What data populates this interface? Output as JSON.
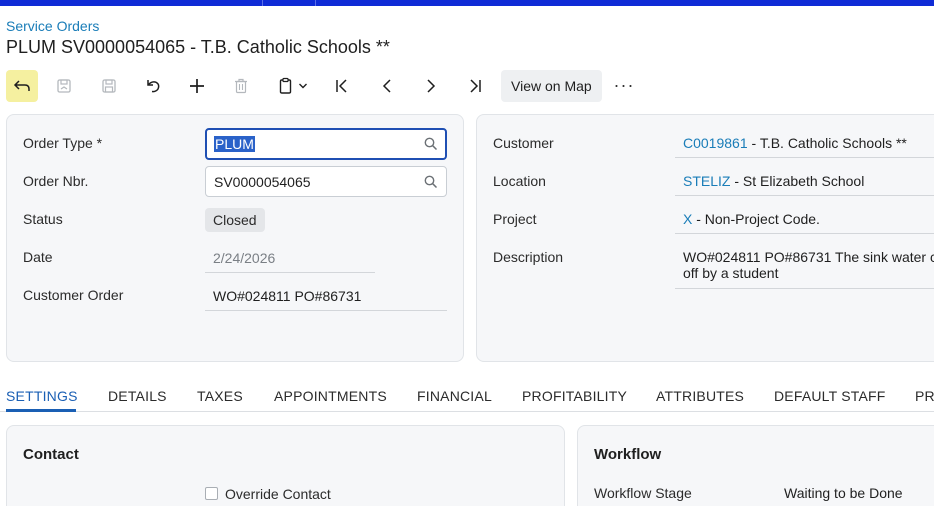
{
  "breadcrumb": "Service Orders",
  "title": "PLUM SV0000054065 - T.B. Catholic Schools **",
  "toolbar": {
    "icons": [
      "back-icon",
      "save-close-icon",
      "save-icon",
      "undo-icon",
      "add-icon",
      "delete-icon",
      "copy-paste-icon",
      "first-record-icon",
      "previous-record-icon",
      "next-record-icon",
      "last-record-icon"
    ],
    "view_on_map": "View on Map",
    "more": "···"
  },
  "left": {
    "order_type_label": "Order Type *",
    "order_type_value": "PLUM",
    "order_nbr_label": "Order Nbr.",
    "order_nbr_value": "SV0000054065",
    "status_label": "Status",
    "status_value": "Closed",
    "date_label": "Date",
    "date_value": "2/24/2026",
    "customer_order_label": "Customer Order",
    "customer_order_value": "WO#024811 PO#86731"
  },
  "right": {
    "customer_label": "Customer",
    "customer_id": "C0019861",
    "customer_name": " - T.B. Catholic Schools **",
    "location_label": "Location",
    "location_id": "STELIZ",
    "location_name": " - St Elizabeth School",
    "project_label": "Project",
    "project_id": "X",
    "project_name": " - Non-Project Code.",
    "description_label": "Description",
    "description_line1": "WO#024811 PO#86731 The sink water c",
    "description_line2": "off by a student"
  },
  "tabs": [
    "SETTINGS",
    "DETAILS",
    "TAXES",
    "APPOINTMENTS",
    "FINANCIAL",
    "PROFITABILITY",
    "ATTRIBUTES",
    "DEFAULT STAFF",
    "PR"
  ],
  "contact": {
    "title": "Contact",
    "override_label": "Override Contact"
  },
  "workflow": {
    "title": "Workflow",
    "stage_label": "Workflow Stage",
    "stage_value": "Waiting to be Done"
  },
  "colors": {
    "accent": "#1a5fb4",
    "link": "#1a7db8",
    "topbar": "#0f2bd6",
    "highlight": "#f5f0a0"
  }
}
